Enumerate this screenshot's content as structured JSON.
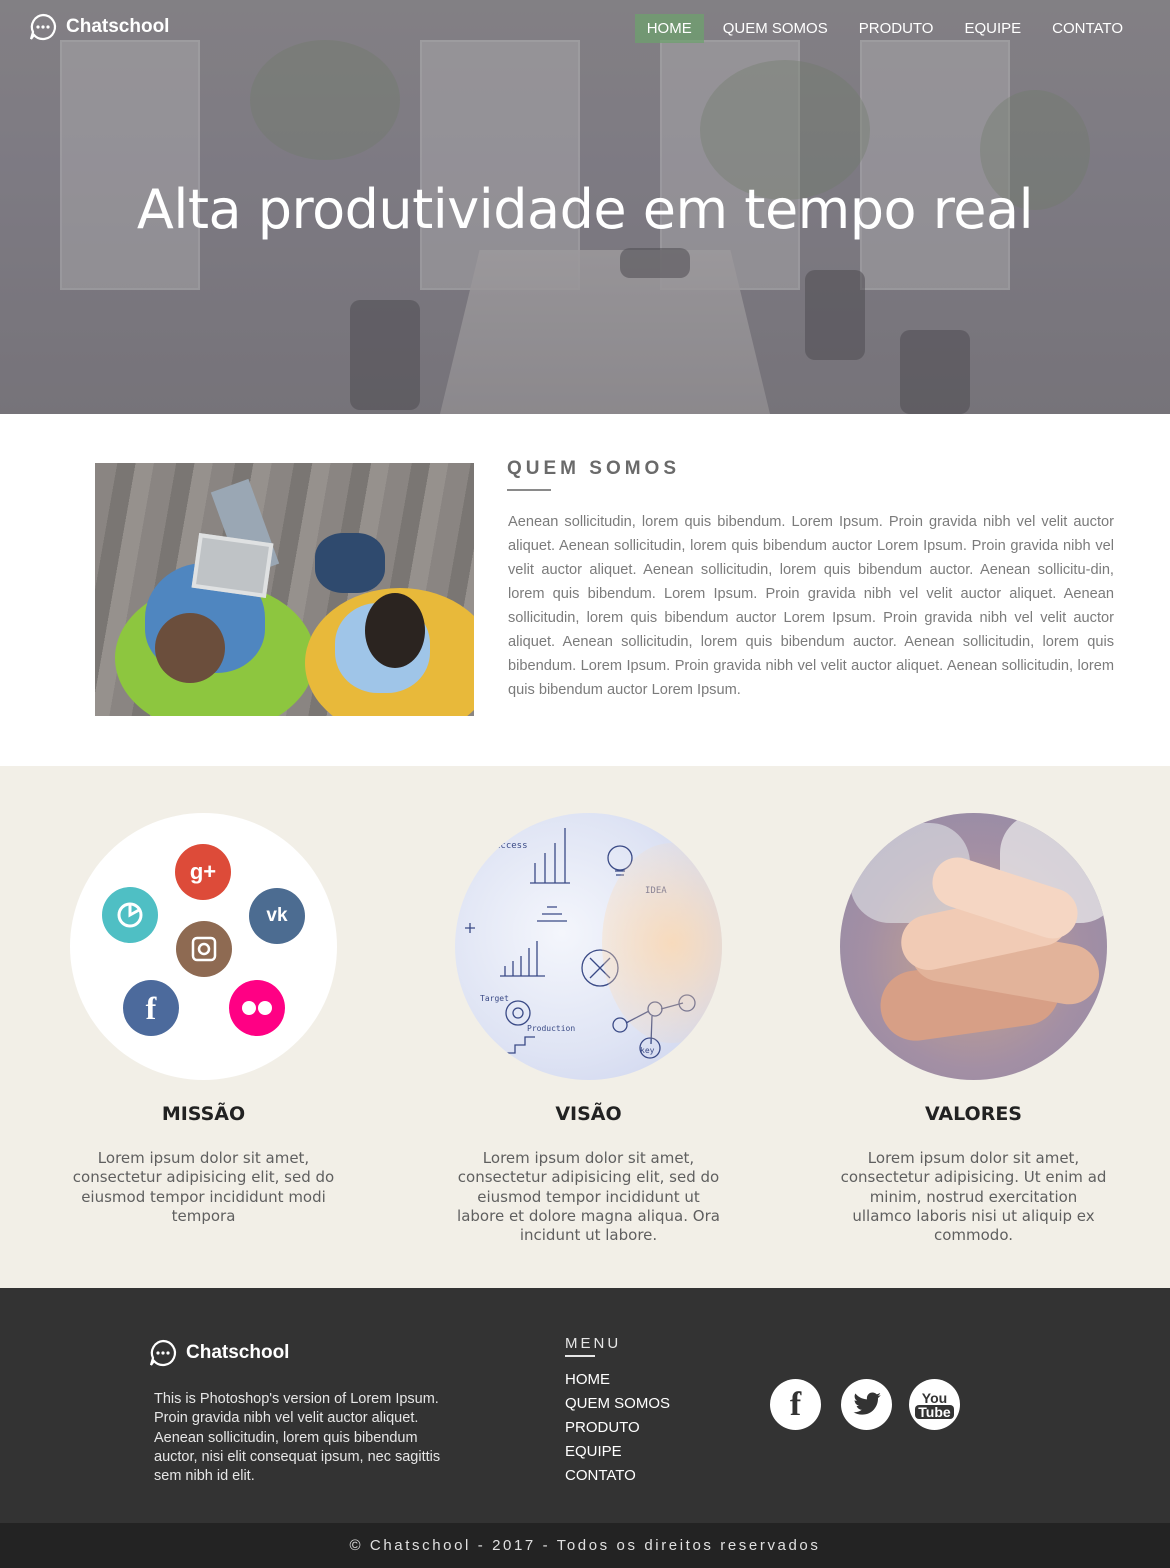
{
  "header": {
    "brand": "Chatschool",
    "nav": [
      {
        "label": "HOME",
        "active": true
      },
      {
        "label": "QUEM SOMOS",
        "active": false
      },
      {
        "label": "PRODUTO",
        "active": false
      },
      {
        "label": "EQUIPE",
        "active": false
      },
      {
        "label": "CONTATO",
        "active": false
      }
    ],
    "active_color": "#6ea06e"
  },
  "hero": {
    "title": "Alta produtividade em tempo real"
  },
  "about": {
    "heading": "QUEM SOMOS",
    "text": "Aenean sollicitudin, lorem quis bibendum. Lorem Ipsum. Proin gravida nibh vel velit auctor aliquet. Aenean sollicitudin, lorem quis bibendum auctor Lorem Ipsum. Proin gravida nibh vel velit auctor aliquet. Aenean sollicitudin, lorem quis bibendum auctor. Aenean sollicitu-din, lorem quis bibendum. Lorem Ipsum. Proin gravida nibh vel velit auctor aliquet. Aenean sollicitudin, lorem quis bibendum auctor Lorem Ipsum. Proin gravida nibh vel velit auctor aliquet. Aenean sollicitudin, lorem quis bibendum auctor. Aenean sollicitudin, lorem quis bibendum. Lorem Ipsum. Proin gravida nibh vel velit auctor aliquet. Aenean sollicitudin, lorem quis bibendum auctor Lorem Ipsum."
  },
  "features": [
    {
      "title": "MISSÃO",
      "text": "Lorem ipsum dolor sit amet, consectetur adipisicing elit, sed do eiusmod tempor incididunt modi tempora"
    },
    {
      "title": "VISÃO",
      "text": "Lorem ipsum dolor sit amet, consectetur adipisicing elit, sed do eiusmod tempor incididunt ut labore et dolore magna aliqua. Ora incidunt ut labore."
    },
    {
      "title": "VALORES",
      "text": "Lorem ipsum dolor sit amet, consectetur adipisicing. Ut enim ad minim, nostrud exercitation ullamco laboris nisi ut aliquip ex commodo."
    }
  ],
  "social_circle": [
    {
      "icon": "google-plus-icon",
      "color": "#dd4b39"
    },
    {
      "icon": "picasa-icon",
      "color": "#4fbfc4"
    },
    {
      "icon": "vk-icon",
      "color": "#4c6c91"
    },
    {
      "icon": "instagram-icon",
      "color": "#8e6a52"
    },
    {
      "icon": "facebook-icon",
      "color": "#4c6a9c"
    },
    {
      "icon": "flickr-icon",
      "color": "#ff0084"
    }
  ],
  "footer": {
    "brand": "Chatschool",
    "text": "This is Photoshop's version  of Lorem Ipsum. Proin gravida nibh vel velit auctor aliquet. Aenean sollicitudin, lorem quis bibendum auctor, nisi elit consequat ipsum, nec sagittis sem nibh id elit.",
    "menu_heading": "MENU",
    "menu": [
      "HOME",
      "QUEM SOMOS",
      "PRODUTO",
      "EQUIPE",
      "CONTATO"
    ],
    "social": [
      "facebook-icon",
      "twitter-icon",
      "youtube-icon"
    ],
    "copyright": "© Chatschool - 2017 - Todos os direitos reservados"
  }
}
